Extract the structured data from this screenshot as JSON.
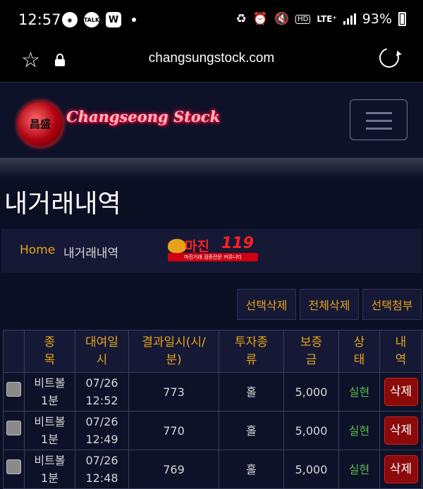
{
  "status_bar": {
    "time": "12:57",
    "notifications": [
      "pokeball-icon",
      "kakaotalk-icon",
      "w-app-icon"
    ],
    "talk_label": "TALK",
    "w_label": "W",
    "hd_label": "HD",
    "lte_label": "LTE⁺",
    "battery": "93%"
  },
  "browser": {
    "url": "changsungstock.com"
  },
  "site": {
    "logo_seal_text": "昌盛",
    "logo_text": "Changseong Stock",
    "page_title": "내거래내역",
    "breadcrumb": {
      "home": "Home",
      "current": "내거래내역"
    },
    "banner": {
      "title": "마진",
      "number": "119",
      "subtitle": "마진거래 검증전문 커뮤니티"
    },
    "actions": [
      "선택삭제",
      "전체삭제",
      "선택첨부"
    ],
    "table": {
      "headers": [
        "",
        "종\n목",
        "대여일\n시",
        "결과일시(시/\n분)",
        "투자종\n류",
        "보증\n금",
        "상\n태",
        "내\n역"
      ],
      "rows": [
        {
          "item": "비트볼\n1분",
          "date": "07/26\n12:52",
          "result": "773",
          "type": "홀",
          "deposit": "5,000",
          "status": "실현",
          "action": "삭제"
        },
        {
          "item": "비트볼\n1분",
          "date": "07/26\n12:49",
          "result": "770",
          "type": "홀",
          "deposit": "5,000",
          "status": "실현",
          "action": "삭제"
        },
        {
          "item": "비트볼\n1분",
          "date": "07/26\n12:48",
          "result": "769",
          "type": "홀",
          "deposit": "5,000",
          "status": "실현",
          "action": "삭제"
        }
      ]
    }
  },
  "colors": {
    "accent": "#e8a21a",
    "status_ok": "#58b84a",
    "danger": "#8c0a0a",
    "bg": "#0b0f24"
  }
}
